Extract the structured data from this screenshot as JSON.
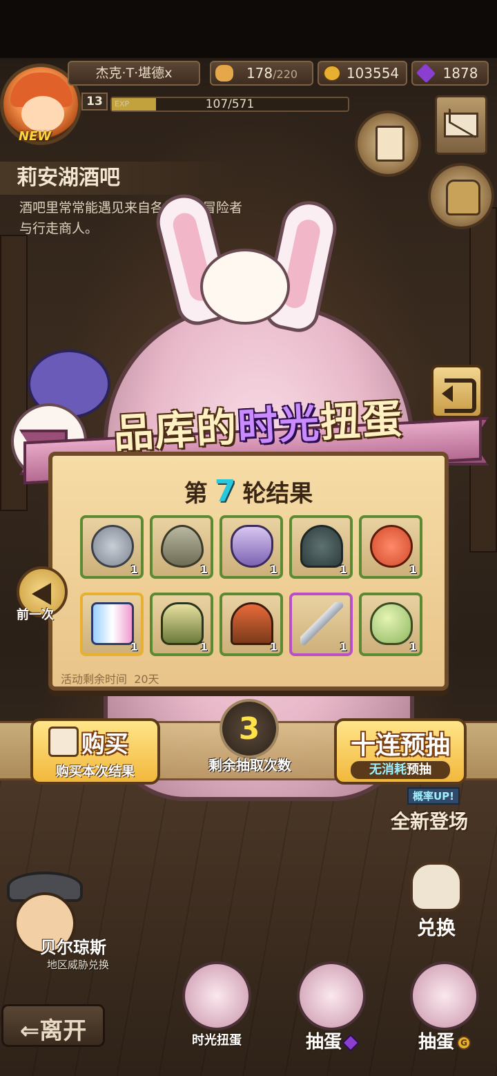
{
  "player": {
    "name": "杰克·T·堪德x",
    "level": "13",
    "exp_label": "EXP",
    "exp_text": "107/571",
    "exp_fraction": 0.187,
    "new_badge": "NEW"
  },
  "resources": {
    "stamina_current": "178",
    "stamina_max": "/220",
    "gold": "103554",
    "gems": "1878"
  },
  "location": {
    "title": "莉安湖酒吧",
    "description": "酒吧里常常能遇见来自各地区的冒险者与行走商人。"
  },
  "banner": {
    "title_part1": "品库的",
    "title_highlight": "时光",
    "title_part2": "扭蛋"
  },
  "results": {
    "round_prefix": "第",
    "round_number": "7",
    "round_suffix": "轮结果",
    "timer_label": "活动剩余时间",
    "timer_value": "20天",
    "items": [
      {
        "icon": "stone-icon",
        "qty": "1",
        "rarity": "common"
      },
      {
        "icon": "leaf-icon",
        "qty": "1",
        "rarity": "common"
      },
      {
        "icon": "crystal-icon",
        "qty": "1",
        "rarity": "common"
      },
      {
        "icon": "turtle-shell-icon",
        "qty": "1",
        "rarity": "common"
      },
      {
        "icon": "crab-icon",
        "qty": "1",
        "rarity": "common"
      },
      {
        "icon": "fairy-card-icon",
        "qty": "1",
        "rarity": "gold"
      },
      {
        "icon": "armor-icon",
        "qty": "1",
        "rarity": "common"
      },
      {
        "icon": "ore-pile-icon",
        "qty": "1",
        "rarity": "common"
      },
      {
        "icon": "dagger-icon",
        "qty": "1",
        "rarity": "purple"
      },
      {
        "icon": "green-egg-icon",
        "qty": "1",
        "rarity": "common"
      }
    ]
  },
  "controls": {
    "prev_label": "前一次",
    "buy_label": "购买",
    "buy_sub": "购买本次结果",
    "draws_remaining": "3",
    "draws_label": "剩余抽取次数",
    "ten_draw_label": "十连预抽",
    "ten_draw_sub_em": "无消耗",
    "ten_draw_sub": "预抽"
  },
  "side": {
    "new_arena_tag": "概率UP!",
    "new_arena_label": "全新登场",
    "exchange_label": "兑换"
  },
  "npc": {
    "name": "贝尔琼斯",
    "subtitle": "地区威胁兑换"
  },
  "dock": {
    "leave_label": "离开",
    "time_gacha_label": "时光扭蛋",
    "gem_gacha_label": "抽蛋",
    "gold_gacha_label": "抽蛋",
    "coin_glyph": "G"
  },
  "colors": {
    "accent_cyan": "#27c7dd",
    "draws_yellow": "#ffe14a",
    "panel_bg": "#f6dca6"
  }
}
